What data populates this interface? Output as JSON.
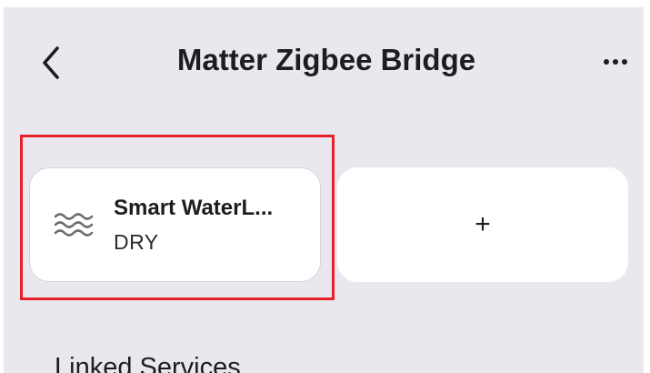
{
  "header": {
    "title": "Matter Zigbee Bridge",
    "back_icon": "chevron-left-icon",
    "more_icon": "ellipsis-icon"
  },
  "tiles": {
    "device": {
      "icon": "water-waves-icon",
      "name": "Smart WaterL...",
      "status": "DRY"
    },
    "add": {
      "label": "+"
    }
  },
  "sections": {
    "linked_services_title": "Linked Services"
  },
  "colors": {
    "background": "#e9e8ee",
    "tile": "#ffffff",
    "highlight": "#e8202a",
    "text": "#1d1d1f"
  }
}
